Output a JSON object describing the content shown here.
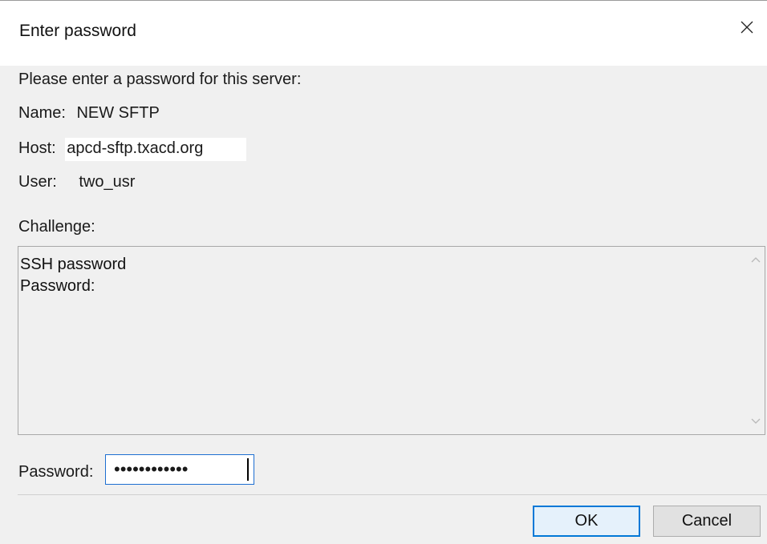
{
  "window": {
    "title": "Enter password"
  },
  "prompt": "Please enter a password for this server:",
  "fields": {
    "name_label": "Name:",
    "name_value": "NEW SFTP",
    "host_label": "Host:",
    "host_value": "apcd-sftp.txacd.org",
    "user_label": "User:",
    "user_value": "two_usr"
  },
  "challenge": {
    "label": "Challenge:",
    "text": "SSH password\nPassword:"
  },
  "password": {
    "label": "Password:",
    "masked_value": "••••••••••••"
  },
  "buttons": {
    "ok_label": "OK",
    "cancel_label": "Cancel"
  },
  "icons": {
    "close": "close-icon",
    "scroll_up": "chevron-up-icon",
    "scroll_down": "chevron-down-icon"
  },
  "colors": {
    "accent": "#0078d7",
    "dialog_bg": "#f0f0f0"
  }
}
